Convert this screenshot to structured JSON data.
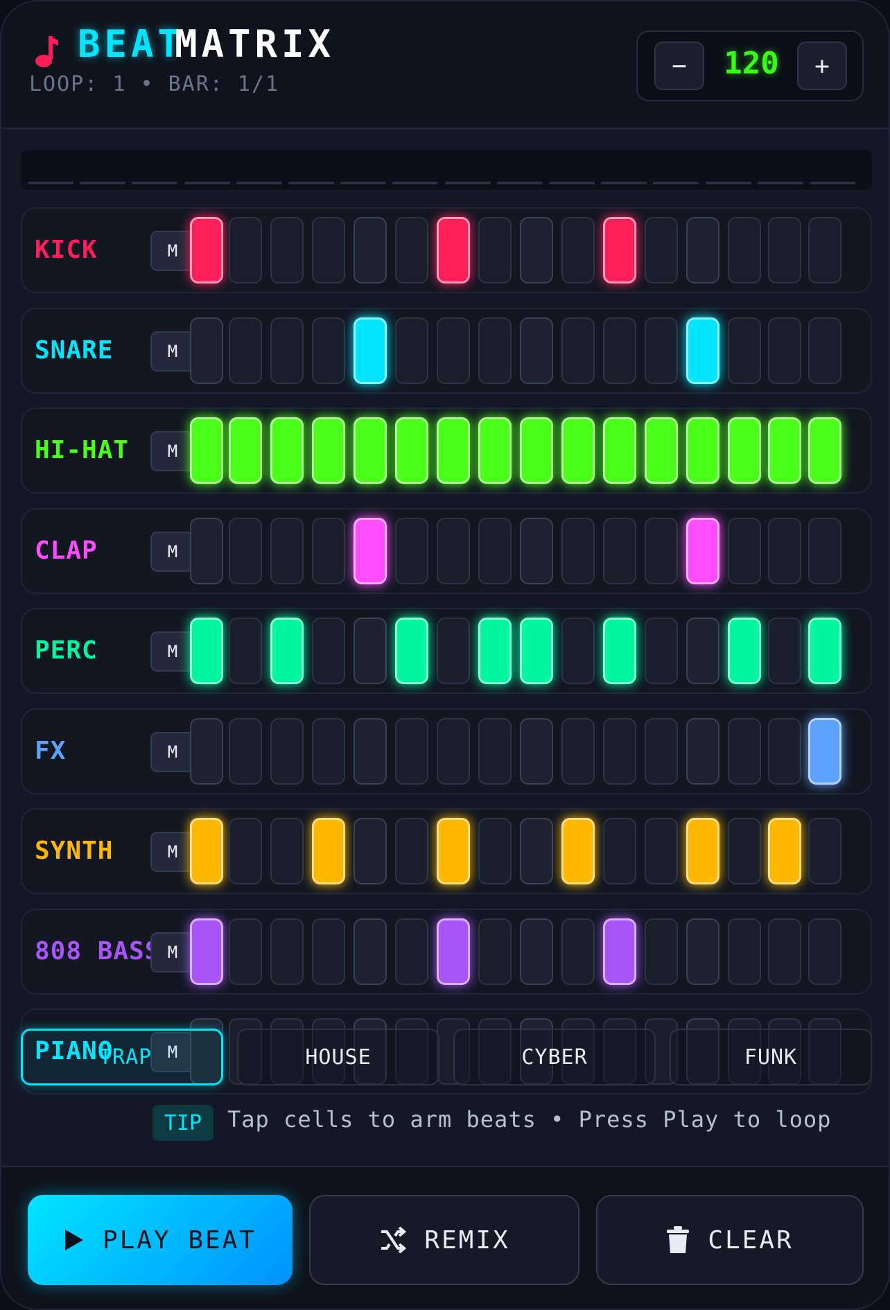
{
  "header": {
    "title_part1": "BEAT",
    "title_part2": "MATRIX",
    "loop_info": "LOOP: 1 • BAR: 1/1",
    "logo_icon": "music-note-icon",
    "bpm": {
      "value": "120",
      "minus_label": "−",
      "plus_label": "+"
    }
  },
  "progress": {
    "segments": 16,
    "current_step": 0
  },
  "mute_label": "M",
  "tracks": [
    {
      "name": "KICK",
      "color": "#ff1f5a",
      "steps": [
        1,
        0,
        0,
        0,
        0,
        0,
        1,
        0,
        0,
        0,
        1,
        0,
        0,
        0,
        0,
        0
      ]
    },
    {
      "name": "SNARE",
      "color": "#00e5ff",
      "steps": [
        0,
        0,
        0,
        0,
        1,
        0,
        0,
        0,
        0,
        0,
        0,
        0,
        1,
        0,
        0,
        0
      ]
    },
    {
      "name": "HI-HAT",
      "color": "#4cff1a",
      "steps": [
        1,
        1,
        1,
        1,
        1,
        1,
        1,
        1,
        1,
        1,
        1,
        1,
        1,
        1,
        1,
        1
      ]
    },
    {
      "name": "CLAP",
      "color": "#ff4dff",
      "steps": [
        0,
        0,
        0,
        0,
        1,
        0,
        0,
        0,
        0,
        0,
        0,
        0,
        1,
        0,
        0,
        0
      ]
    },
    {
      "name": "PERC",
      "color": "#00f5a0",
      "steps": [
        1,
        0,
        1,
        0,
        0,
        1,
        0,
        1,
        1,
        0,
        1,
        0,
        0,
        1,
        0,
        1
      ]
    },
    {
      "name": "FX",
      "color": "#5ea2ff",
      "steps": [
        0,
        0,
        0,
        0,
        0,
        0,
        0,
        0,
        0,
        0,
        0,
        0,
        0,
        0,
        0,
        1
      ]
    },
    {
      "name": "SYNTH",
      "color": "#ffb800",
      "steps": [
        1,
        0,
        0,
        1,
        0,
        0,
        1,
        0,
        0,
        1,
        0,
        0,
        1,
        0,
        1,
        0
      ]
    },
    {
      "name": "808 BASS",
      "color": "#a855f7",
      "steps": [
        1,
        0,
        0,
        0,
        0,
        0,
        1,
        0,
        0,
        0,
        1,
        0,
        0,
        0,
        0,
        0
      ]
    },
    {
      "name": "PIANO",
      "color": "#00e5ff",
      "steps": [
        0,
        0,
        0,
        0,
        0,
        0,
        0,
        0,
        0,
        0,
        0,
        0,
        0,
        0,
        0,
        0
      ]
    }
  ],
  "presets": [
    {
      "label": "TRAP",
      "active": true
    },
    {
      "label": "HOUSE",
      "active": false
    },
    {
      "label": "CYBER",
      "active": false
    },
    {
      "label": "FUNK",
      "active": false
    }
  ],
  "tip": {
    "badge": "TIP",
    "text": "Tap cells to arm beats • Press Play to loop"
  },
  "footer": {
    "play_label": "PLAY BEAT",
    "remix_label": "REMIX",
    "clear_label": "CLEAR",
    "play_icon": "play-icon",
    "remix_icon": "shuffle-icon",
    "clear_icon": "trash-icon"
  }
}
